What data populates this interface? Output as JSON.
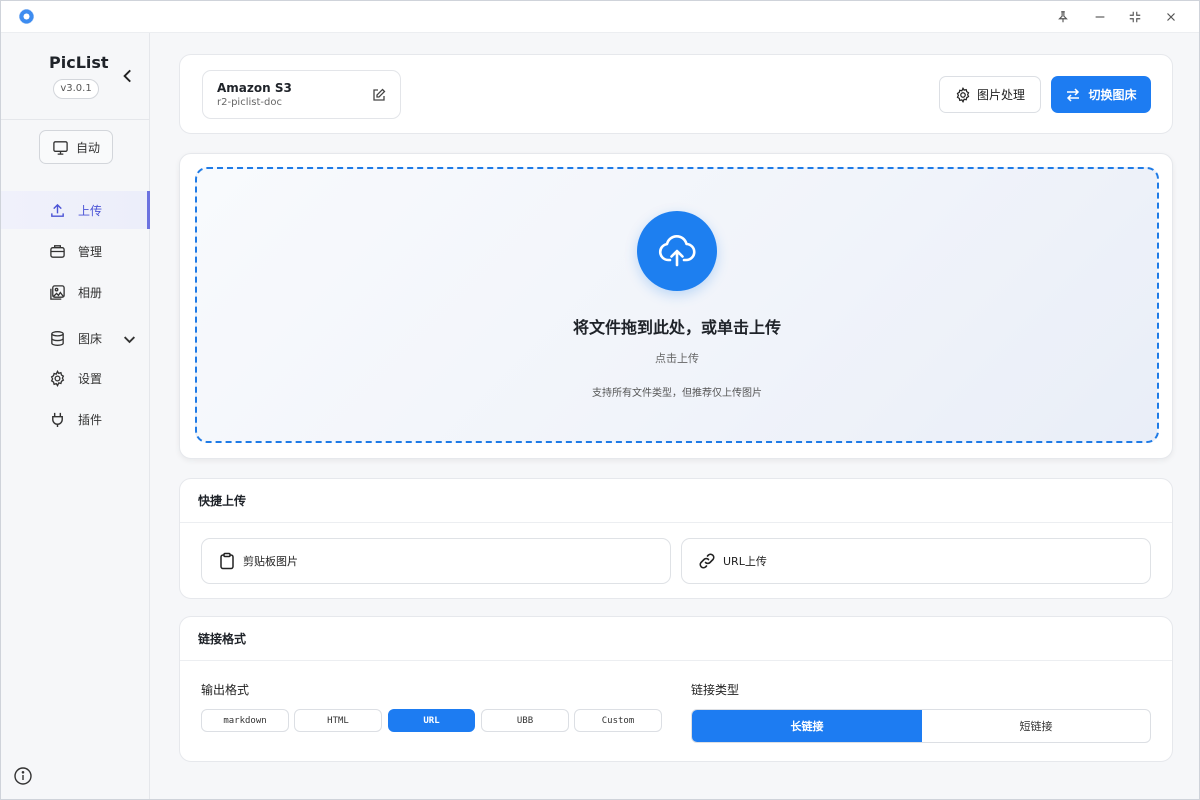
{
  "app": {
    "name": "PicList",
    "version": "v3.0.1"
  },
  "theme": {
    "accent": "#1d7cf2",
    "nav_active": "#4c54d6"
  },
  "sidebar": {
    "mode_button": "自动",
    "items": [
      {
        "label": "上传",
        "icon": "upload-icon",
        "active": true
      },
      {
        "label": "管理",
        "icon": "briefcase-icon"
      },
      {
        "label": "相册",
        "icon": "gallery-icon"
      },
      {
        "label": "图床",
        "icon": "database-icon",
        "has_submenu": true
      },
      {
        "label": "设置",
        "icon": "gear-icon"
      },
      {
        "label": "插件",
        "icon": "plug-icon"
      }
    ]
  },
  "picbed": {
    "name": "Amazon S3",
    "config": "r2-piclist-doc"
  },
  "toolbar": {
    "image_process": "图片处理",
    "switch_picbed": "切换图床"
  },
  "upload": {
    "title": "将文件拖到此处，或单击上传",
    "subtitle": "点击上传",
    "hint": "支持所有文件类型，但推荐仅上传图片"
  },
  "quick_upload": {
    "title": "快捷上传",
    "clipboard": "剪贴板图片",
    "url": "URL上传"
  },
  "link_format": {
    "title": "链接格式",
    "output_label": "输出格式",
    "formats": [
      "markdown",
      "HTML",
      "URL",
      "UBB",
      "Custom"
    ],
    "selected_format": "URL",
    "type_label": "链接类型",
    "types": [
      "长链接",
      "短链接"
    ],
    "selected_type": "长链接"
  }
}
